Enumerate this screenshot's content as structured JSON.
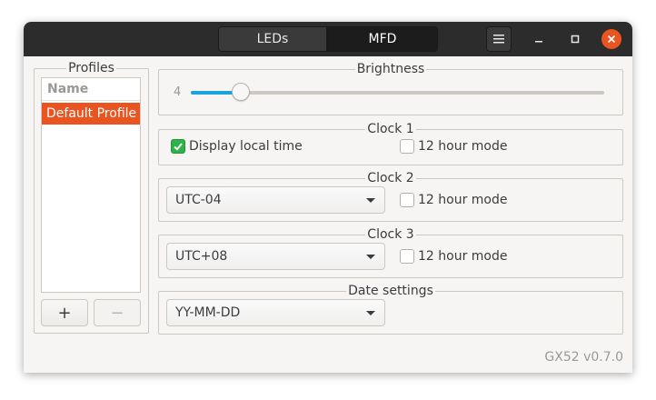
{
  "tabs": [
    "LEDs",
    "MFD"
  ],
  "active_tab": "MFD",
  "window_controls": [
    "menu-icon",
    "minimize-icon",
    "maximize-icon",
    "close-icon"
  ],
  "colors": {
    "accent": "#e95420",
    "slider": "#19a5dc",
    "checkbox": "#2eb34a"
  },
  "profiles": {
    "label": "Profiles",
    "column_header": "Name",
    "items": [
      "Default Profile"
    ],
    "selected": "Default Profile",
    "add_label": "+",
    "remove_label": "−"
  },
  "brightness": {
    "label": "Brightness",
    "value": "4",
    "fraction": 0.12
  },
  "clock1": {
    "label": "Clock 1",
    "local_time_label": "Display local time",
    "local_time_checked": true,
    "hour12_label": "12 hour mode",
    "hour12_checked": false
  },
  "clock2": {
    "label": "Clock 2",
    "timezone": "UTC-04",
    "hour12_label": "12 hour mode",
    "hour12_checked": false
  },
  "clock3": {
    "label": "Clock 3",
    "timezone": "UTC+08",
    "hour12_label": "12 hour mode",
    "hour12_checked": false
  },
  "date_settings": {
    "label": "Date settings",
    "format": "YY-MM-DD"
  },
  "version": "GX52 v0.7.0"
}
